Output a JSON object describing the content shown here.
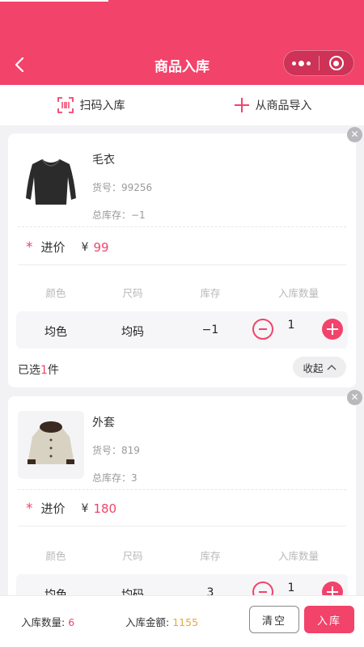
{
  "header": {
    "title": "商品入库"
  },
  "actions": {
    "scan_label": "扫码入库",
    "import_label": "从商品导入"
  },
  "colors": {
    "accent": "#f2436b",
    "gold": "#e6a93a"
  },
  "table_headers": {
    "color": "颜色",
    "size": "尺码",
    "stock": "库存",
    "qty": "入库数量"
  },
  "products": [
    {
      "name": "毛衣",
      "code": "货号：99256",
      "total_stock": "总库存：−1",
      "price_label": "进价",
      "currency": "¥",
      "price": "99",
      "row": {
        "color": "均色",
        "size": "均码",
        "stock": "−1",
        "qty": "1"
      },
      "selected_prefix": "已选",
      "selected_count": "1",
      "selected_suffix": "件",
      "collapse_label": "收起"
    },
    {
      "name": "外套",
      "code": "货号：819",
      "total_stock": "总库存：3",
      "price_label": "进价",
      "currency": "¥",
      "price": "180",
      "row": {
        "color": "均色",
        "size": "均码",
        "stock": "3",
        "qty": "1"
      }
    }
  ],
  "footer": {
    "count_label": "入库数量:",
    "count_value": "6",
    "amount_label": "入库金额:",
    "amount_value": "1155",
    "clear_label": "清空",
    "submit_label": "入库"
  }
}
